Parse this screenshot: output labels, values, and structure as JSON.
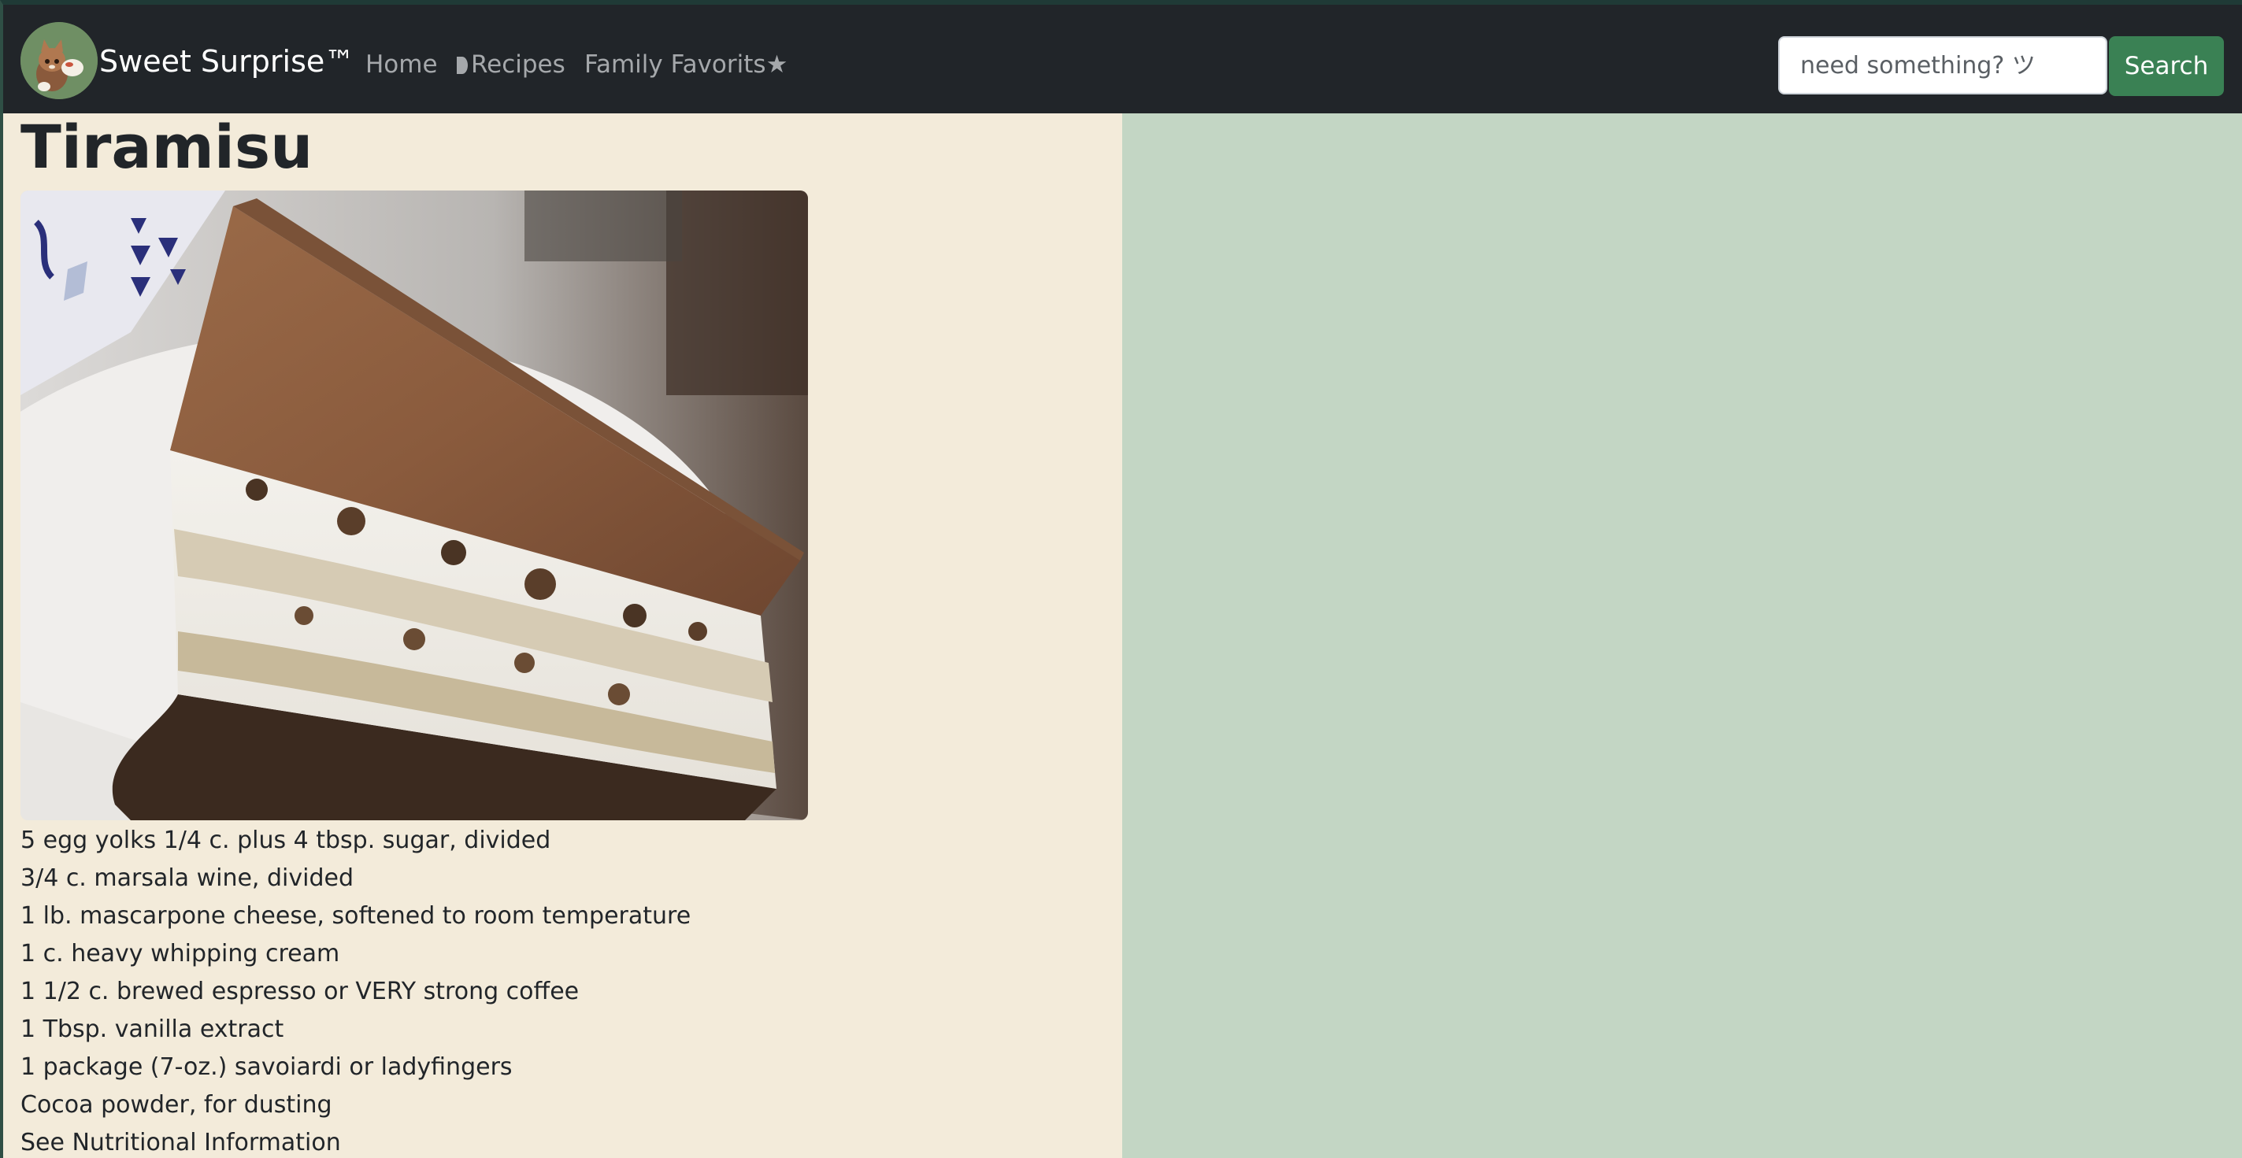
{
  "navbar": {
    "brand": "Sweet Surprise™",
    "logo_icon": "cat-chef-logo",
    "links": [
      {
        "label": "Home"
      },
      {
        "label": "Recipes",
        "icon": "half-moon-icon"
      },
      {
        "label": "Family Favorits★"
      }
    ],
    "search": {
      "placeholder": "need something? ツ",
      "button_label": "Search"
    }
  },
  "recipe": {
    "title": "Tiramisu",
    "image_icon": "tiramisu-photo",
    "ingredients": [
      "5 egg yolks 1/4 c. plus 4 tbsp. sugar, divided",
      "3/4 c. marsala wine, divided",
      "1 lb. mascarpone cheese, softened to room temperature",
      "1 c. heavy whipping cream",
      "1 1/2 c. brewed espresso or VERY strong coffee",
      "1 Tbsp. vanilla extract",
      "1 package (7-oz.) savoiardi or ladyfingers",
      "Cocoa powder, for dusting",
      "See Nutritional Information"
    ]
  },
  "colors": {
    "navbar_bg": "#212529",
    "content_bg": "#f3ebda",
    "page_bg": "#c3d6c4",
    "search_button": "#3a8154"
  }
}
